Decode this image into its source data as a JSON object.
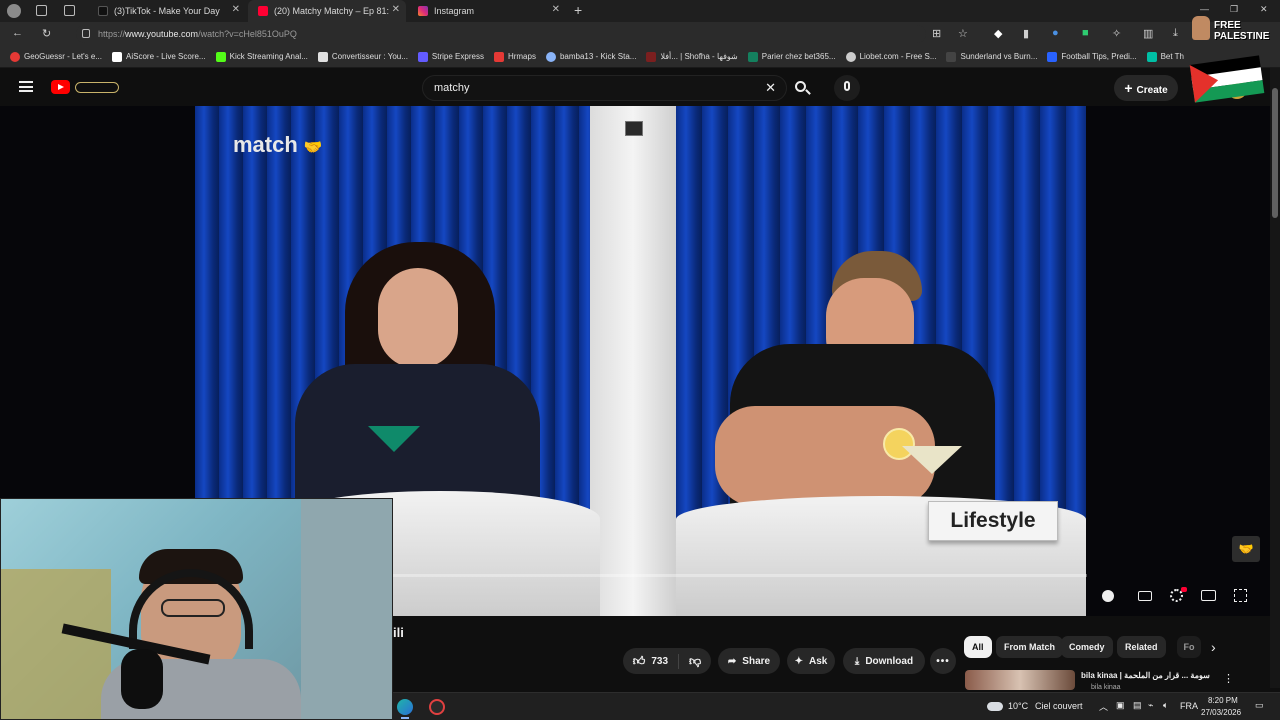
{
  "browser": {
    "tabs": [
      {
        "title": "(3)TikTok - Make Your Day",
        "color": "#222222"
      },
      {
        "title": "(20) Matchy Matchy – Ep 81: S",
        "color": "#ff0033"
      },
      {
        "title": "Instagram",
        "color": "#d6249f"
      }
    ],
    "new_tab_glyph": "+",
    "url_prefix": "https://",
    "url_host": "www.youtube.com",
    "url_path": "/watch?v=cHel851OuPQ"
  },
  "bookmarks": [
    {
      "label": "GeoGuessr - Let's e...",
      "color": "#e53935"
    },
    {
      "label": "AiScore - Live Score...",
      "color": "#ffffff"
    },
    {
      "label": "Kick Streaming Anal...",
      "color": "#53fc18"
    },
    {
      "label": "Convertisseur : You...",
      "color": "#e0e0e0"
    },
    {
      "label": "Stripe Express",
      "color": "#635bff"
    },
    {
      "label": "Hrmaps",
      "color": "#e53935"
    },
    {
      "label": "bamba13 - Kick Sta...",
      "color": "#8ab4f8"
    },
    {
      "label": "أفلا... | Shofha - شوفها",
      "color": "#7b1f1f"
    },
    {
      "label": "Parier chez bet365...",
      "color": "#14805e"
    },
    {
      "label": "Liobet.com - Free S...",
      "color": "#cccccc"
    },
    {
      "label": "Sunderland vs Burn...",
      "color": "#444444"
    },
    {
      "label": "Football Tips, Predi...",
      "color": "#2962ff"
    },
    {
      "label": "Bet Th",
      "color": "#00bfa5"
    }
  ],
  "youtube": {
    "search_value": "matchy",
    "create_label": "Create",
    "brand_color": "#ff0000"
  },
  "video": {
    "show_logo": "match",
    "placard_text": "Lifestyle",
    "title_fragment": "ili"
  },
  "actions": {
    "like_count": "733",
    "share_label": "Share",
    "ask_label": "Ask",
    "download_label": "Download"
  },
  "chips": [
    "All",
    "From Match",
    "Comedy",
    "Related",
    "Fo"
  ],
  "recommendation": {
    "title": "bila kinaa | سومة ... قرار من الملحمة",
    "channel": "bila kinaa"
  },
  "taskbar": {
    "temperature": "10°C",
    "weather": "Ciel couvert",
    "language": "FRA",
    "time": "8:20 PM",
    "date": "27/03/2026"
  },
  "overlay": {
    "free_palestine": "FREE PALESTINE"
  }
}
